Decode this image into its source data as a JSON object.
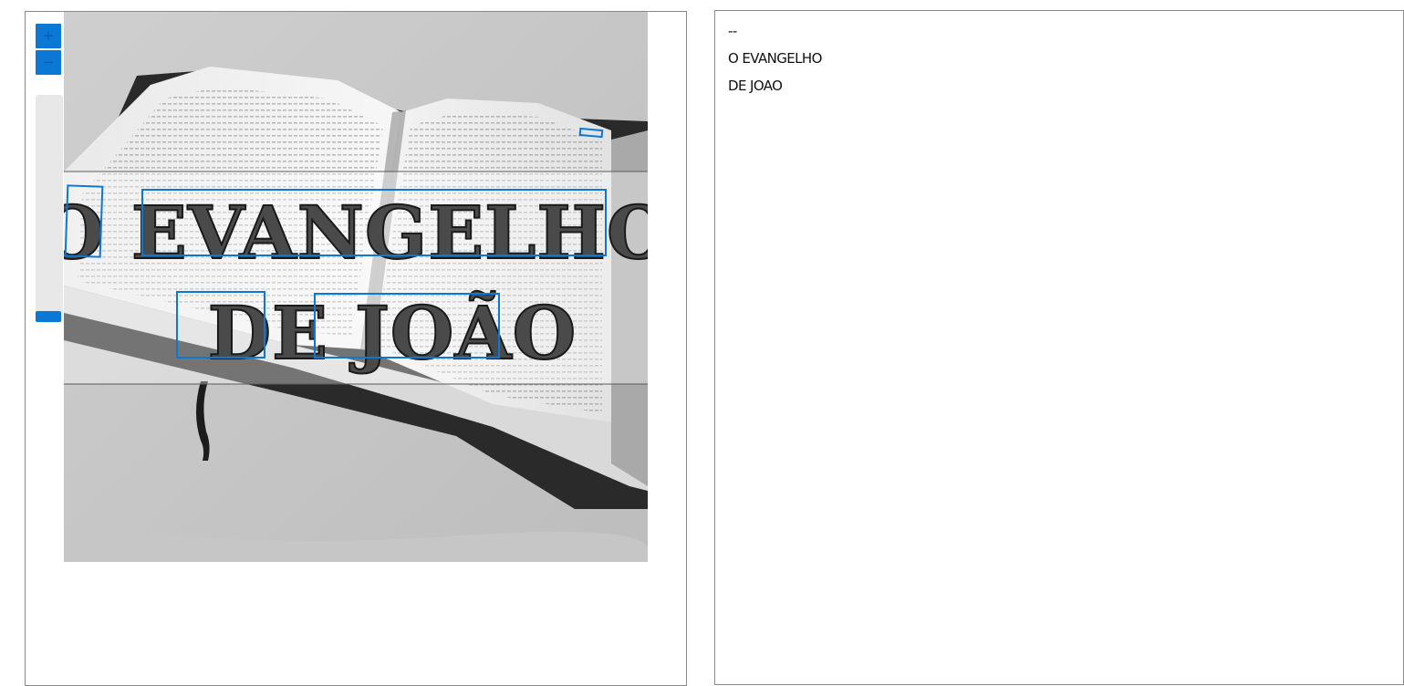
{
  "viewer": {
    "zoom_in_label": "+",
    "zoom_out_label": "−",
    "accent_color": "#0a78d4",
    "image": {
      "page_text_title": "O EVANGELHO",
      "page_text_subtitle": "DE JOÃO",
      "detected_words": [
        "O",
        "EVANGELHO",
        "DE",
        "JOÃO"
      ]
    }
  },
  "result": {
    "lines": [
      "--",
      "O EVANGELHO",
      "DE JOAO"
    ]
  }
}
